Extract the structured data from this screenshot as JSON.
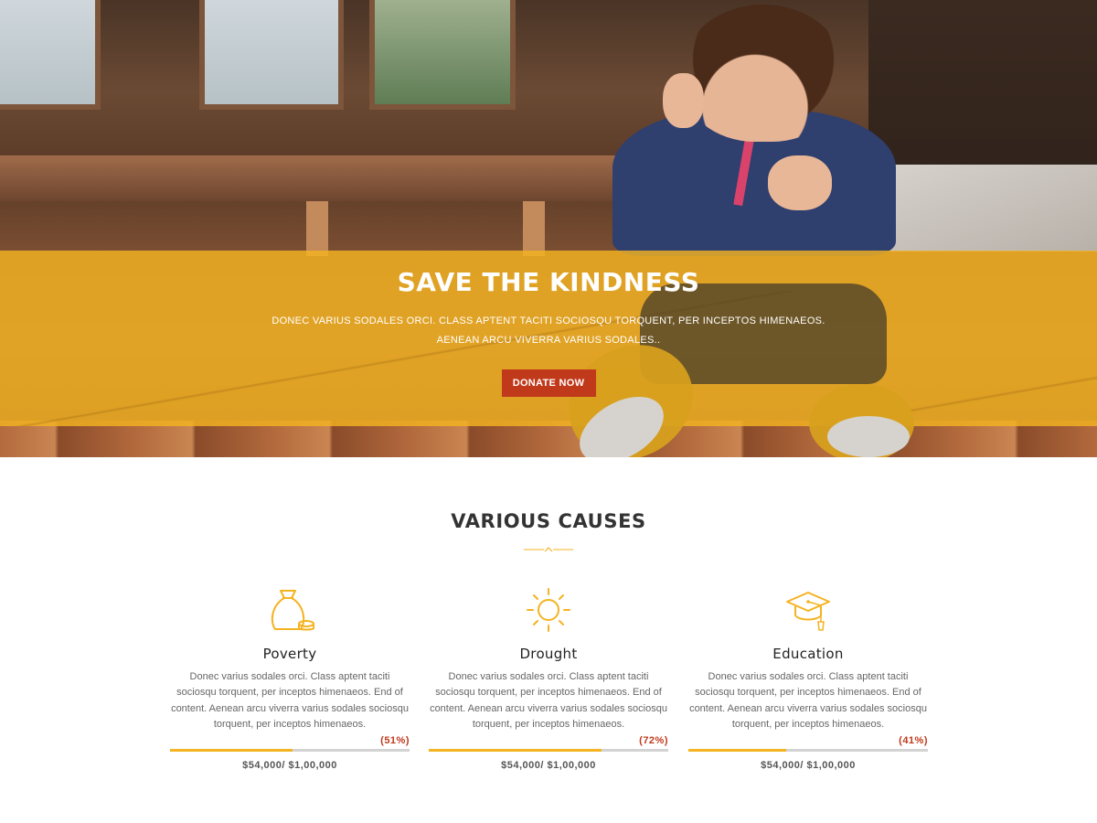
{
  "hero": {
    "title": "SAVE THE KINDNESS",
    "subtitle": "DONEC VARIUS SODALES ORCI. CLASS APTENT TACITI SOCIOSQU TORQUENT, PER INCEPTOS HIMENAEOS. AENEAN ARCU VIVERRA VARIUS SODALES..",
    "cta_label": "DONATE NOW"
  },
  "causes_section": {
    "title": "VARIOUS CAUSES",
    "items": [
      {
        "icon": "money-bag-icon",
        "title": "Poverty",
        "description": "Donec varius sodales orci. Class aptent taciti sociosqu torquent, per inceptos himenaeos. End of content. Aenean arcu viverra varius sodales sociosqu torquent, per inceptos himenaeos.",
        "percent_label": "(51%)",
        "progress": 0.51,
        "amount": "$54,000/ $1,00,000"
      },
      {
        "icon": "sun-icon",
        "title": "Drought",
        "description": "Donec varius sodales orci. Class aptent taciti sociosqu torquent, per inceptos himenaeos. End of content. Aenean arcu viverra varius sodales sociosqu torquent, per inceptos himenaeos.",
        "percent_label": "(72%)",
        "progress": 0.72,
        "amount": "$54,000/ $1,00,000"
      },
      {
        "icon": "graduation-cap-icon",
        "title": "Education",
        "description": "Donec varius sodales orci. Class aptent taciti sociosqu torquent, per inceptos himenaeos. End of content. Aenean arcu viverra varius sodales sociosqu torquent, per inceptos himenaeos.",
        "percent_label": "(41%)",
        "progress": 0.41,
        "amount": "$54,000/ $1,00,000"
      }
    ]
  },
  "colors": {
    "accent_yellow": "#f4b321",
    "button_red": "#c0391b",
    "heading": "#333333",
    "body_text": "#666666"
  }
}
